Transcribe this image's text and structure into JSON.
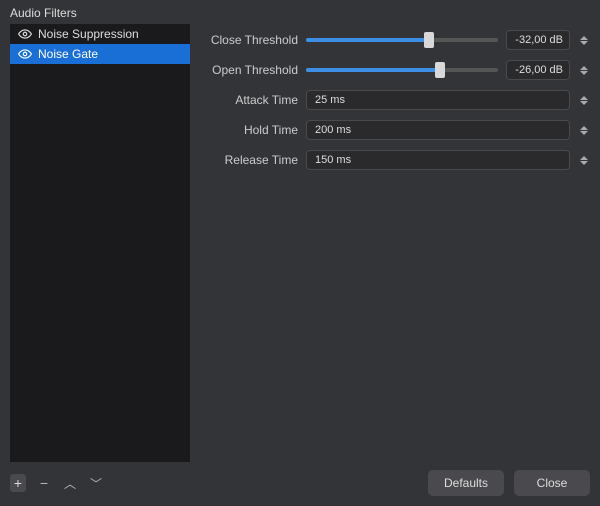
{
  "title": "Audio Filters",
  "sidebar": {
    "items": [
      {
        "label": "Noise Suppression",
        "selected": false
      },
      {
        "label": "Noise Gate",
        "selected": true
      }
    ]
  },
  "params": {
    "close_threshold": {
      "label": "Close Threshold",
      "value": "-32,00 dB",
      "fill_pct": 64
    },
    "open_threshold": {
      "label": "Open Threshold",
      "value": "-26,00 dB",
      "fill_pct": 70
    },
    "attack_time": {
      "label": "Attack Time",
      "value": "25 ms"
    },
    "hold_time": {
      "label": "Hold Time",
      "value": "200 ms"
    },
    "release_time": {
      "label": "Release Time",
      "value": "150 ms"
    }
  },
  "footer": {
    "defaults": "Defaults",
    "close": "Close"
  }
}
